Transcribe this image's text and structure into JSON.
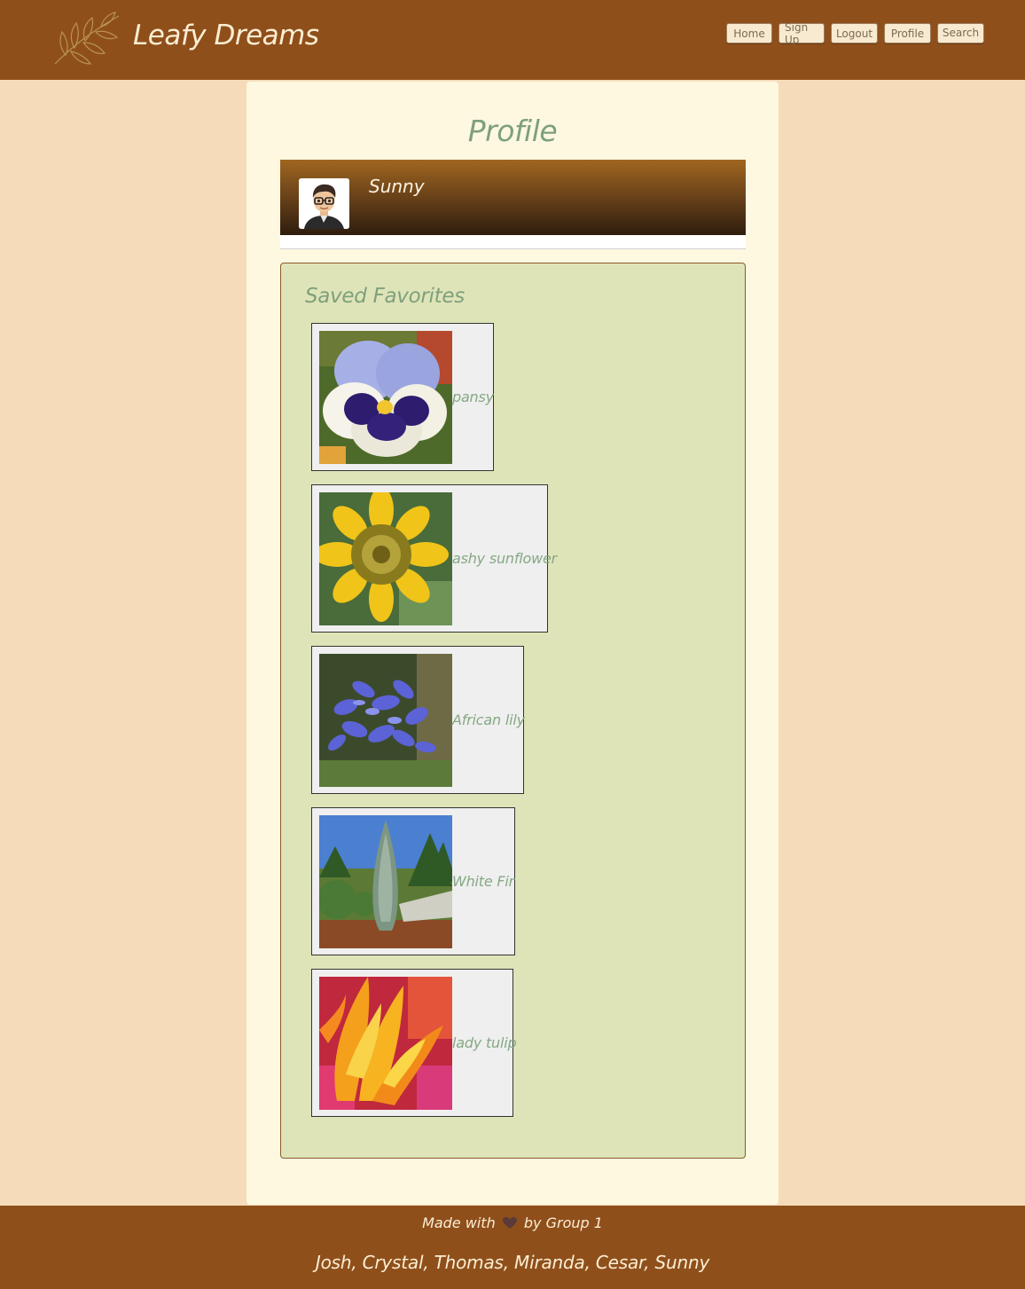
{
  "header": {
    "brand": "Leafy Dreams",
    "logo_icon": "leaf-branch-icon",
    "nav": [
      {
        "label": "Home"
      },
      {
        "label": "Sign Up"
      },
      {
        "label": "Logout"
      },
      {
        "label": "Profile"
      },
      {
        "label": "Search"
      }
    ]
  },
  "main": {
    "title": "Profile",
    "user": {
      "name": "Sunny",
      "avatar_icon": "cartoon-person-glasses-icon"
    },
    "favorites": {
      "title": "Saved Favorites",
      "items": [
        {
          "name": "pansy",
          "image": "pansy-flower-photo"
        },
        {
          "name": "ashy sunflower",
          "image": "sunflower-photo"
        },
        {
          "name": "African lily",
          "image": "african-lily-photo"
        },
        {
          "name": "White Fir",
          "image": "white-fir-tree-photo"
        },
        {
          "name": "lady tulip",
          "image": "tulip-photo"
        }
      ]
    }
  },
  "footer": {
    "made_with_prefix": "Made with",
    "made_with_suffix": "by Group 1",
    "heart_icon": "heart-icon",
    "credits": "Josh, Crystal, Thomas, Miranda, Cesar, Sunny"
  },
  "colors": {
    "header_bg": "#8f4f1b",
    "page_bg": "#f5dbb9",
    "card_bg": "#fef8e1",
    "panel_bg": "#dfe4b8",
    "accent_green": "#7ea07c"
  }
}
